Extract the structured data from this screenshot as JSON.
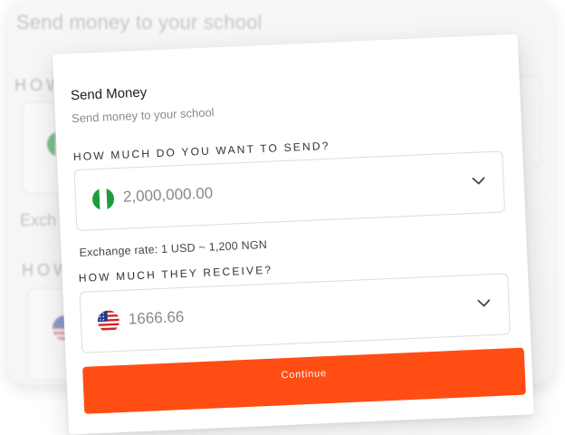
{
  "background": {
    "subtitle": "Send money to your school",
    "label_send_partial": "HOW",
    "exchange_partial": "Exch",
    "label_receive_partial": "HOW"
  },
  "modal": {
    "title": "Send Money",
    "subtitle": "Send money to your school",
    "send": {
      "label": "HOW MUCH DO YOU WANT TO SEND?",
      "flag_icon": "nigeria-flag-icon",
      "amount": "2,000,000.00",
      "currency": "NGN"
    },
    "exchange_rate": "Exchange rate: 1 USD ~ 1,200 NGN",
    "receive": {
      "label": "HOW MUCH THEY RECEIVE?",
      "flag_icon": "us-flag-icon",
      "amount": "1666.66",
      "currency": "USD"
    },
    "continue_label": "Continue"
  },
  "colors": {
    "accent": "#ff4d14",
    "nigeria_green": "#1e9b3b",
    "us_red": "#d8232a",
    "us_blue": "#1f3a8a"
  }
}
